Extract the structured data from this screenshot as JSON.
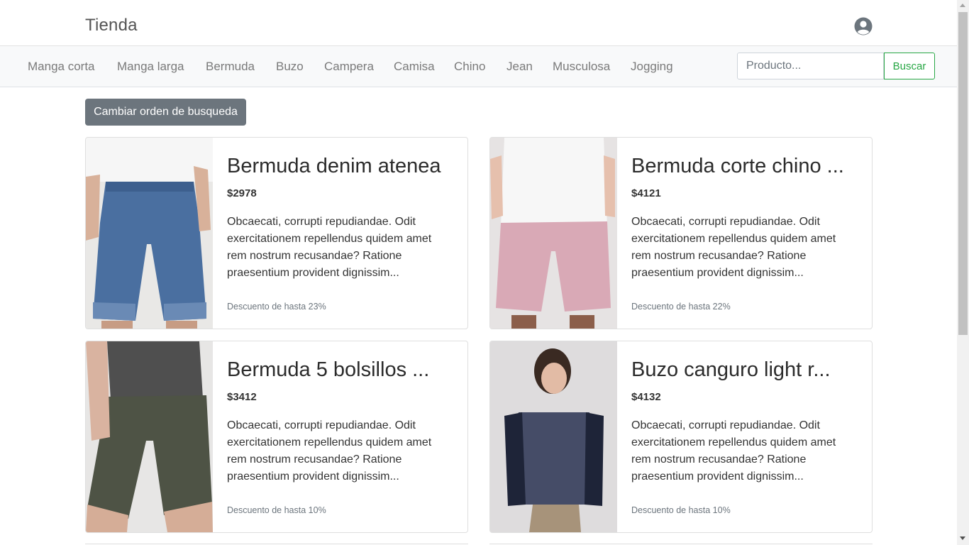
{
  "header": {
    "brand": "Tienda",
    "user_icon": "user-circle-icon"
  },
  "nav": {
    "categories": [
      "Manga corta",
      "Manga larga",
      "Bermuda",
      "Buzo",
      "Campera",
      "Camisa",
      "Chino",
      "Jean",
      "Musculosa",
      "Jogging"
    ],
    "search_placeholder": "Producto...",
    "search_value": "",
    "search_button": "Buscar"
  },
  "sort_button": "Cambiar orden de busqueda",
  "products": [
    {
      "title": "Bermuda denim atenea",
      "price": "$2978",
      "description": "Obcaecati, corrupti repudiandae. Odit exercitationem repellendus quidem amet rem nostrum recusandae? Ratione praesentium provident dignissim...",
      "discount": "Descuento de hasta 23%"
    },
    {
      "title": "Bermuda corte chino ...",
      "price": "$4121",
      "description": "Obcaecati, corrupti repudiandae. Odit exercitationem repellendus quidem amet rem nostrum recusandae? Ratione praesentium provident dignissim...",
      "discount": "Descuento de hasta 22%"
    },
    {
      "title": "Bermuda 5 bolsillos ...",
      "price": "$3412",
      "description": "Obcaecati, corrupti repudiandae. Odit exercitationem repellendus quidem amet rem nostrum recusandae? Ratione praesentium provident dignissim...",
      "discount": "Descuento de hasta 10%"
    },
    {
      "title": "Buzo canguro light r...",
      "price": "$4132",
      "description": "Obcaecati, corrupti repudiandae. Odit exercitationem repellendus quidem amet rem nostrum recusandae? Ratione praesentium provident dignissim...",
      "discount": "Descuento de hasta 10%"
    }
  ],
  "colors": {
    "success": "#28a745",
    "secondary": "#6c757d",
    "navbar_bg": "#f8f9fa"
  }
}
